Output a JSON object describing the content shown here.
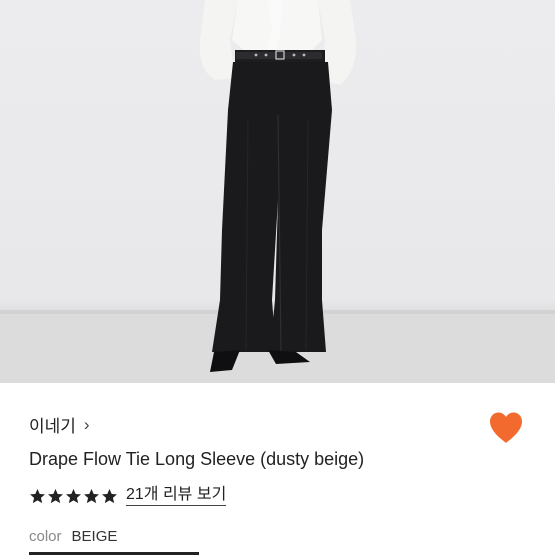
{
  "product": {
    "brand": "이네기",
    "brand_chevron": "›",
    "title": "Drape Flow Tie Long Sleeve (dusty beige)",
    "rating_stars": 5,
    "reviews_link": "21개 리뷰 보기",
    "option_label": "color",
    "option_value": "BEIGE",
    "wishlisted": true
  },
  "colors": {
    "heart": "#f26a2e",
    "stars": "#222222"
  },
  "icons": {
    "chevron": "chevron-right-icon",
    "wishlist": "heart-icon",
    "rating": "star-icon"
  }
}
